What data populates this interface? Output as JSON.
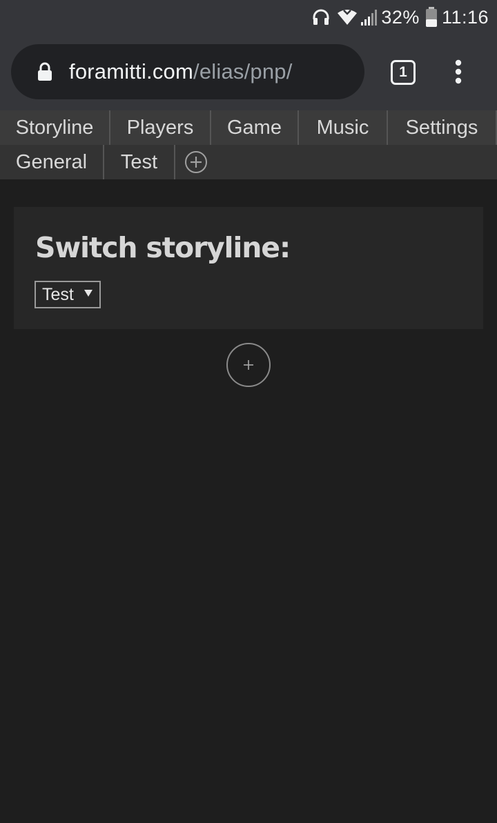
{
  "status_bar": {
    "battery_percent": "32%",
    "time": "11:16",
    "icons": [
      "headphones-icon",
      "wifi-icon",
      "signal-icon",
      "battery-icon"
    ]
  },
  "browser": {
    "url_domain": "foramitti.com",
    "url_path": "/elias/pnp/",
    "tab_count": "1",
    "icons": [
      "lock-icon",
      "more-vert-icon"
    ]
  },
  "nav": {
    "row1": [
      {
        "label": "Storyline"
      },
      {
        "label": "Players"
      },
      {
        "label": "Game"
      },
      {
        "label": "Music"
      },
      {
        "label": "Settings"
      }
    ],
    "row2": [
      {
        "label": "General"
      },
      {
        "label": "Test"
      }
    ],
    "add_icon": "plus-circle-icon"
  },
  "main": {
    "card_title": "Switch storyline:",
    "storyline_select": {
      "selected": "Test"
    },
    "add_icon": "plus-icon"
  },
  "colors": {
    "page_background": "#1e1e1e",
    "chrome_background": "#35363a",
    "nav_row1_background": "#3b3b3b",
    "nav_row2_background": "#333333",
    "card_background": "#272727",
    "text": "#d8d8d8",
    "url_path": "#9aa0a6"
  }
}
